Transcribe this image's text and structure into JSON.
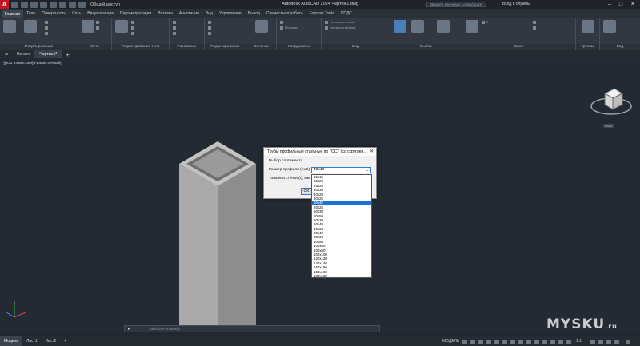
{
  "app": {
    "logo_letter": "A",
    "share_label": "Общий доступ",
    "window_title": "Autodesk AutoCAD 2024   Чертеж1.dwg",
    "search_placeholder": "Введите ключевое слово/фразу",
    "signin": "Вход в службы"
  },
  "ribbon_tabs": [
    "Главная",
    "Тело",
    "Поверхность",
    "Сеть",
    "Визуализация",
    "Параметризация",
    "Вставка",
    "Аннотации",
    "Вид",
    "Управление",
    "Вывод",
    "Совместная работа",
    "Express Tools",
    "СПДС"
  ],
  "ribbon_panels": {
    "modeling": "Моделирование",
    "mesh": "Сеть",
    "solid_edit": "Редактирование тела",
    "draw": "Рисование",
    "modify": "Редактирование",
    "section": "Сечение",
    "coordinates": "Координаты",
    "view": "Вид",
    "selection": "Выбор",
    "layers": "Слои",
    "groups": "Группы",
    "view2": "Вид"
  },
  "ribbon_controls": {
    "view_style": "Нереалистичный",
    "view_preset": "Неизвестный вид",
    "layer_dropdown": "0",
    "world_label": "Мировая"
  },
  "file_tabs": [
    "Начало",
    "Чертеж1*"
  ],
  "viewport_controls": "[-][ЮЗ изометрия][Реалистичный]",
  "dialog": {
    "title": "Трубы профильные стальные по ГОСТ (со скруглен...",
    "subtitle": "Выбор сортамента",
    "size_label": "Размер профиля (AxB):",
    "size_value": "40x40",
    "wall_label": "Толщина стенки (t), мм:",
    "ok_label": "OK"
  },
  "size_options": [
    "15x15",
    "20x20",
    "25x25",
    "30x30",
    "40x20",
    "40x25",
    "40x40",
    "50x25",
    "50x30",
    "50x50",
    "60x30",
    "60x40",
    "60x60",
    "80x40",
    "80x60",
    "80x80",
    "100x50",
    "100x60",
    "100x100",
    "120x120",
    "140x140",
    "150x150",
    "160x160",
    "180x180",
    "200x200"
  ],
  "selected_size": "40x40",
  "command_placeholder": "Введите команду",
  "layout_tabs": [
    "Модель",
    "Лист1",
    "Лист2"
  ],
  "status": {
    "model_label": "МОДЕЛЬ",
    "scale": "1:1"
  },
  "viewcube_label": "WCS",
  "watermark": {
    "text": "MYSKU",
    "suffix": ".ru"
  }
}
